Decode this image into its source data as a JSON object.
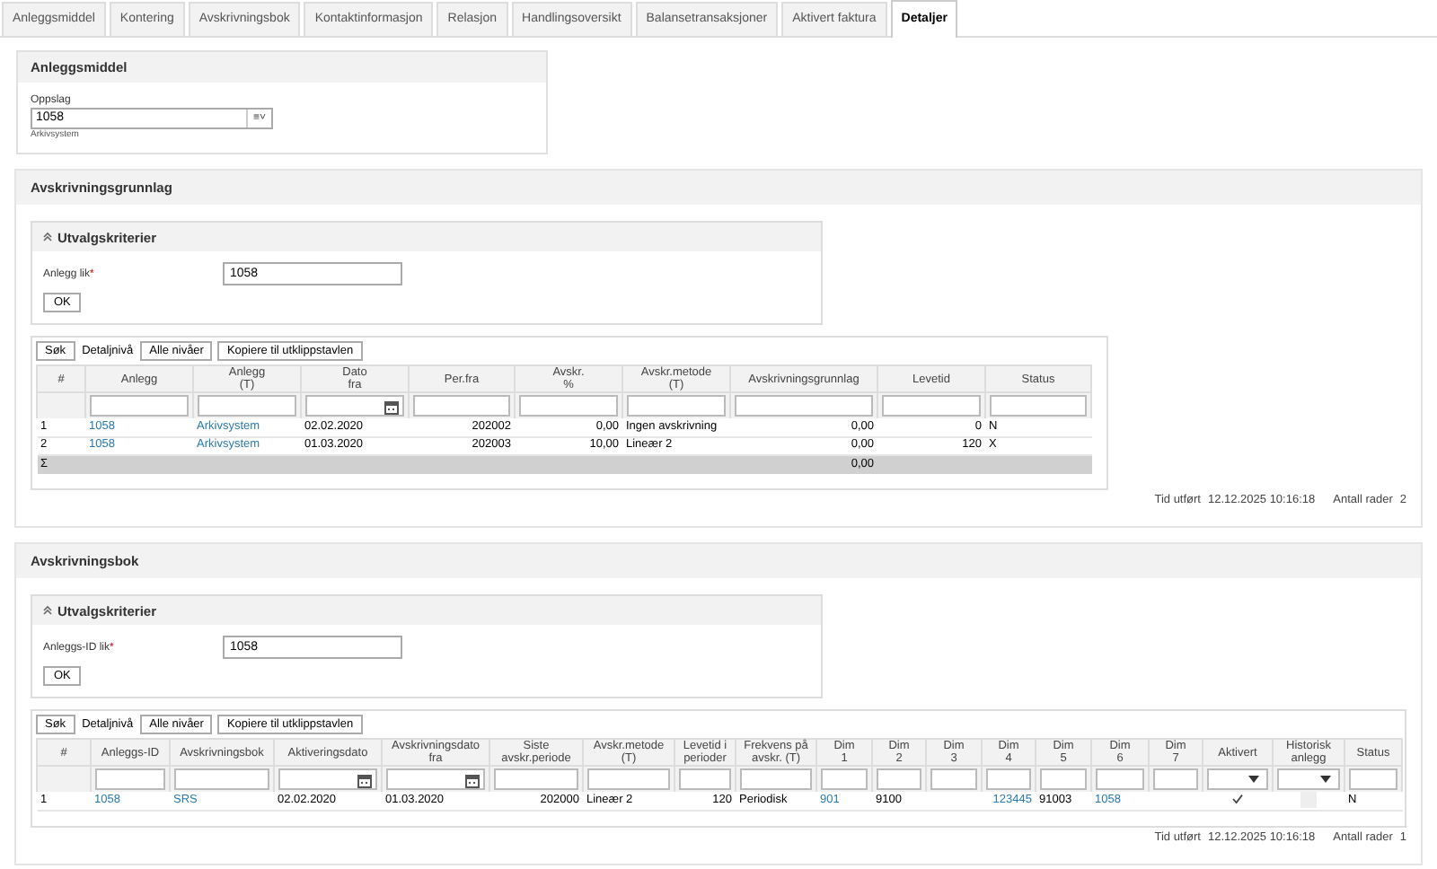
{
  "tabs": [
    {
      "label": "Anleggsmiddel",
      "selected": false
    },
    {
      "label": "Kontering",
      "selected": false
    },
    {
      "label": "Avskrivningsbok",
      "selected": false
    },
    {
      "label": "Kontaktinformasjon",
      "selected": false
    },
    {
      "label": "Relasjon",
      "selected": false
    },
    {
      "label": "Handlingsoversikt",
      "selected": false
    },
    {
      "label": "Balansetransaksjoner",
      "selected": false
    },
    {
      "label": "Aktivert faktura",
      "selected": false
    },
    {
      "label": "Detaljer",
      "selected": true
    }
  ],
  "asset_panel": {
    "title": "Anleggsmiddel",
    "label": "Oppslag",
    "value": "1058",
    "icon_text": "≡˅",
    "caption": "Arkivsystem"
  },
  "sections": [
    {
      "title": "Avskrivningsgrunnlag",
      "criteria": {
        "title": "Utvalgskriterier",
        "expanded": true,
        "label": "Anlegg lik",
        "required": true,
        "required_mark": "*",
        "value": "1058",
        "button": "OK"
      },
      "toolbar": [
        {
          "label": "Søk",
          "kind": "button"
        },
        {
          "label": "Detaljnivå",
          "kind": "label"
        },
        {
          "label": "Alle nivåer",
          "kind": "button"
        },
        {
          "label": "Kopiere til utklippstavlen",
          "kind": "button"
        }
      ],
      "table": {
        "columns": [
          {
            "label": "#",
            "kind": "plain"
          },
          {
            "label": "Anlegg",
            "kind": "text"
          },
          {
            "label": "Anlegg\n(T)",
            "kind": "text"
          },
          {
            "label": "Dato\nfra",
            "kind": "date"
          },
          {
            "label": "Per.fra",
            "kind": "text"
          },
          {
            "label": "Avskr.\n%",
            "kind": "text"
          },
          {
            "label": "Avskr.metode\n(T)",
            "kind": "text"
          },
          {
            "label": "Avskrivningsgrunnlag",
            "kind": "text"
          },
          {
            "label": "Levetid",
            "kind": "text"
          },
          {
            "label": "Status",
            "kind": "text"
          }
        ],
        "rows": [
          [
            {
              "text": "1"
            },
            {
              "text": "1058",
              "link": true
            },
            {
              "text": "Arkivsystem",
              "link": true
            },
            {
              "text": "02.02.2020"
            },
            {
              "text": "202002"
            },
            {
              "text": "0,00"
            },
            {
              "text": "Ingen avskrivning"
            },
            {
              "text": "0,00"
            },
            {
              "text": "0"
            },
            {
              "text": "N"
            }
          ],
          [
            {
              "text": "2"
            },
            {
              "text": "1058",
              "link": true
            },
            {
              "text": "Arkivsystem",
              "link": true
            },
            {
              "text": "01.03.2020"
            },
            {
              "text": "202003"
            },
            {
              "text": "10,00"
            },
            {
              "text": "Lineær 2"
            },
            {
              "text": "0,00"
            },
            {
              "text": "120"
            },
            {
              "text": "X"
            }
          ]
        ],
        "sum_row": {
          "symbol": "Σ",
          "total": "0,00"
        }
      },
      "footer": {
        "time_label": "Tid utført",
        "time": "12.12.2025 10:16:18",
        "rows_label": "Antall rader",
        "rows": "2"
      }
    },
    {
      "title": "Avskrivningsbok",
      "criteria": {
        "title": "Utvalgskriterier",
        "expanded": true,
        "label": "Anleggs-ID lik",
        "required": true,
        "required_mark": "*",
        "value": "1058",
        "button": "OK"
      },
      "toolbar": [
        {
          "label": "Søk",
          "kind": "button"
        },
        {
          "label": "Detaljnivå",
          "kind": "label"
        },
        {
          "label": "Alle nivåer",
          "kind": "button"
        },
        {
          "label": "Kopiere til utklippstavlen",
          "kind": "button"
        }
      ],
      "table": {
        "columns": [
          {
            "label": "#",
            "kind": "plain"
          },
          {
            "label": "Anleggs-ID",
            "kind": "text"
          },
          {
            "label": "Avskrivningsbok",
            "kind": "text"
          },
          {
            "label": "Aktiveringsdato",
            "kind": "date"
          },
          {
            "label": "Avskrivningsdato\nfra",
            "kind": "date"
          },
          {
            "label": "Siste\navskr.periode",
            "kind": "text"
          },
          {
            "label": "Avskr.metode\n(T)",
            "kind": "text"
          },
          {
            "label": "Levetid i\nperioder",
            "kind": "text"
          },
          {
            "label": "Frekvens på\navskr. (T)",
            "kind": "text"
          },
          {
            "label": "Dim\n1",
            "kind": "text"
          },
          {
            "label": "Dim\n2",
            "kind": "text"
          },
          {
            "label": "Dim\n3",
            "kind": "text"
          },
          {
            "label": "Dim\n4",
            "kind": "text"
          },
          {
            "label": "Dim\n5",
            "kind": "text"
          },
          {
            "label": "Dim\n6",
            "kind": "text"
          },
          {
            "label": "Dim\n7",
            "kind": "text"
          },
          {
            "label": "Aktivert",
            "kind": "select"
          },
          {
            "label": "Historisk\nanlegg",
            "kind": "select"
          },
          {
            "label": "Status",
            "kind": "text"
          }
        ],
        "rows": [
          [
            {
              "text": "1"
            },
            {
              "text": "1058",
              "link": true
            },
            {
              "text": "SRS",
              "link": true
            },
            {
              "text": "02.02.2020"
            },
            {
              "text": "01.03.2020"
            },
            {
              "text": "202000"
            },
            {
              "text": "Lineær 2"
            },
            {
              "text": "120"
            },
            {
              "text": "Periodisk"
            },
            {
              "text": "901",
              "link": true
            },
            {
              "text": "9100"
            },
            {
              "kind": "empty"
            },
            {
              "text": "123445",
              "link": true
            },
            {
              "text": "91003"
            },
            {
              "text": "1058",
              "link": true
            },
            {
              "kind": "empty"
            },
            {
              "kind": "check",
              "checked": true
            },
            {
              "kind": "check",
              "checked": false
            },
            {
              "text": "N"
            }
          ]
        ]
      },
      "footer": {
        "time_label": "Tid utført",
        "time": "12.12.2025 10:16:18",
        "rows_label": "Antall rader",
        "rows": "1"
      }
    }
  ]
}
